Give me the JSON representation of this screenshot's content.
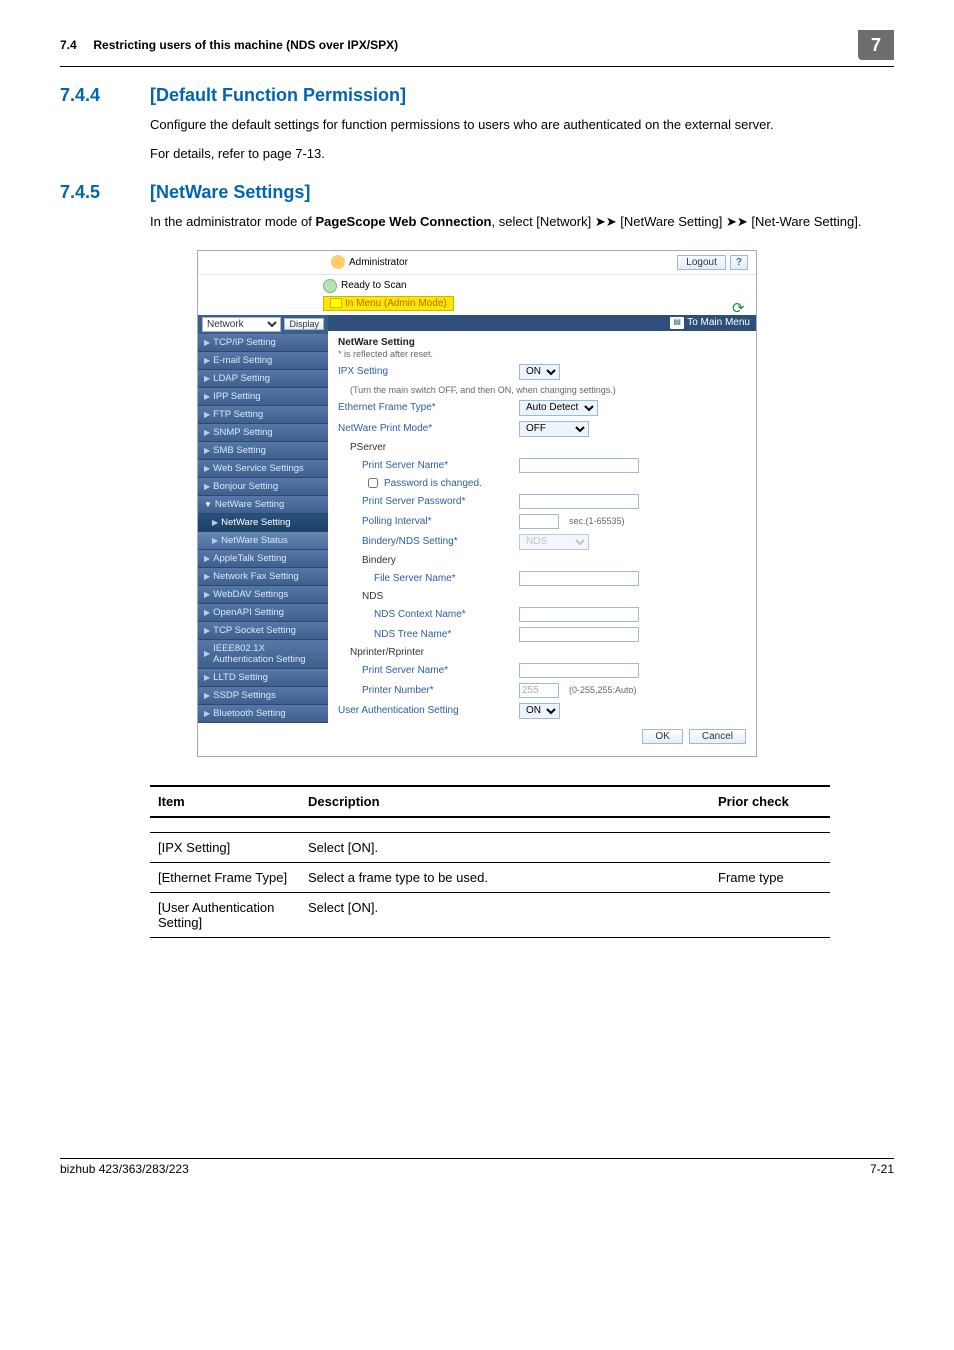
{
  "header": {
    "section_ref": "7.4",
    "section_title": "Restricting users of this machine (NDS over IPX/SPX)",
    "page_tag": "7"
  },
  "sec744": {
    "num": "7.4.4",
    "title": "[Default Function Permission]",
    "p1": "Configure the default settings for function permissions to users who are authenticated on the external server.",
    "p2": "For details, refer to page 7-13."
  },
  "sec745": {
    "num": "7.4.5",
    "title": "[NetWare Settings]",
    "p_a": "In the administrator mode of ",
    "p_bold": "PageScope Web Connection",
    "p_b": ", select [Network] ",
    "p_c": " [NetWare Setting] ",
    "p_d": " [Net-Ware Setting]."
  },
  "shot": {
    "admin_label": "Administrator",
    "logout": "Logout",
    "help": "?",
    "ready": "Ready to Scan",
    "menu_mode": "In Menu (Admin Mode)",
    "to_main": "To Main Menu",
    "display_btn": "Display",
    "network_sel": "Network",
    "nav": [
      {
        "t": "TCP/IP Setting",
        "sub": false
      },
      {
        "t": "E-mail Setting",
        "sub": false
      },
      {
        "t": "LDAP Setting",
        "sub": false
      },
      {
        "t": "IPP Setting",
        "sub": false
      },
      {
        "t": "FTP Setting",
        "sub": false
      },
      {
        "t": "SNMP Setting",
        "sub": false
      },
      {
        "t": "SMB Setting",
        "sub": false
      },
      {
        "t": "Web Service Settings",
        "sub": false
      },
      {
        "t": "Bonjour Setting",
        "sub": false
      },
      {
        "t": "NetWare Setting",
        "sub": false,
        "open": true
      },
      {
        "t": "NetWare Setting",
        "sub": true,
        "sel": true
      },
      {
        "t": "NetWare Status",
        "sub": true
      },
      {
        "t": "AppleTalk Setting",
        "sub": false
      },
      {
        "t": "Network Fax Setting",
        "sub": false
      },
      {
        "t": "WebDAV Settings",
        "sub": false
      },
      {
        "t": "OpenAPI Setting",
        "sub": false
      },
      {
        "t": "TCP Socket Setting",
        "sub": false
      },
      {
        "t": "IEEE802.1X Authentication Setting",
        "sub": false
      },
      {
        "t": "LLTD Setting",
        "sub": false
      },
      {
        "t": "SSDP Settings",
        "sub": false
      },
      {
        "t": "Bluetooth Setting",
        "sub": false
      }
    ],
    "content": {
      "title": "NetWare Setting",
      "note": "* is reflected after reset.",
      "rows": {
        "ipx_label": "IPX Setting",
        "ipx_val": "ON",
        "turn_note": "(Turn the main switch OFF, and then ON, when changing settings.)",
        "eft_label": "Ethernet Frame Type*",
        "eft_val": "Auto Detect",
        "npm_label": "NetWare Print Mode*",
        "npm_val": "OFF",
        "pserver": "PServer",
        "psn_label": "Print Server Name*",
        "pwd_chk": "Password is changed.",
        "psp_label": "Print Server Password*",
        "poll_label": "Polling Interval*",
        "poll_hint": "sec.(1-65535)",
        "bns_label": "Bindery/NDS Setting*",
        "bns_val": "NDS",
        "bindery": "Bindery",
        "fsn_label": "File Server Name*",
        "nds": "NDS",
        "ndscn_label": "NDS Context Name*",
        "ndstn_label": "NDS Tree Name*",
        "nprinter": "Nprinter/Rprinter",
        "psn2_label": "Print Server Name*",
        "pn_label": "Printer Number*",
        "pn_val": "255",
        "pn_hint": "(0-255,255:Auto)",
        "uas_label": "User Authentication Setting",
        "uas_val": "ON"
      },
      "ok": "OK",
      "cancel": "Cancel"
    }
  },
  "table": {
    "h1": "Item",
    "h2": "Description",
    "h3": "Prior check",
    "rows": [
      {
        "c1": "[IPX Setting]",
        "c2": "Select [ON].",
        "c3": ""
      },
      {
        "c1": "[Ethernet Frame Type]",
        "c2": "Select a frame type to be used.",
        "c3": "Frame type"
      },
      {
        "c1": "[User Authentication Setting]",
        "c2": "Select [ON].",
        "c3": ""
      }
    ]
  },
  "footer": {
    "model": "bizhub 423/363/283/223",
    "page": "7-21"
  }
}
